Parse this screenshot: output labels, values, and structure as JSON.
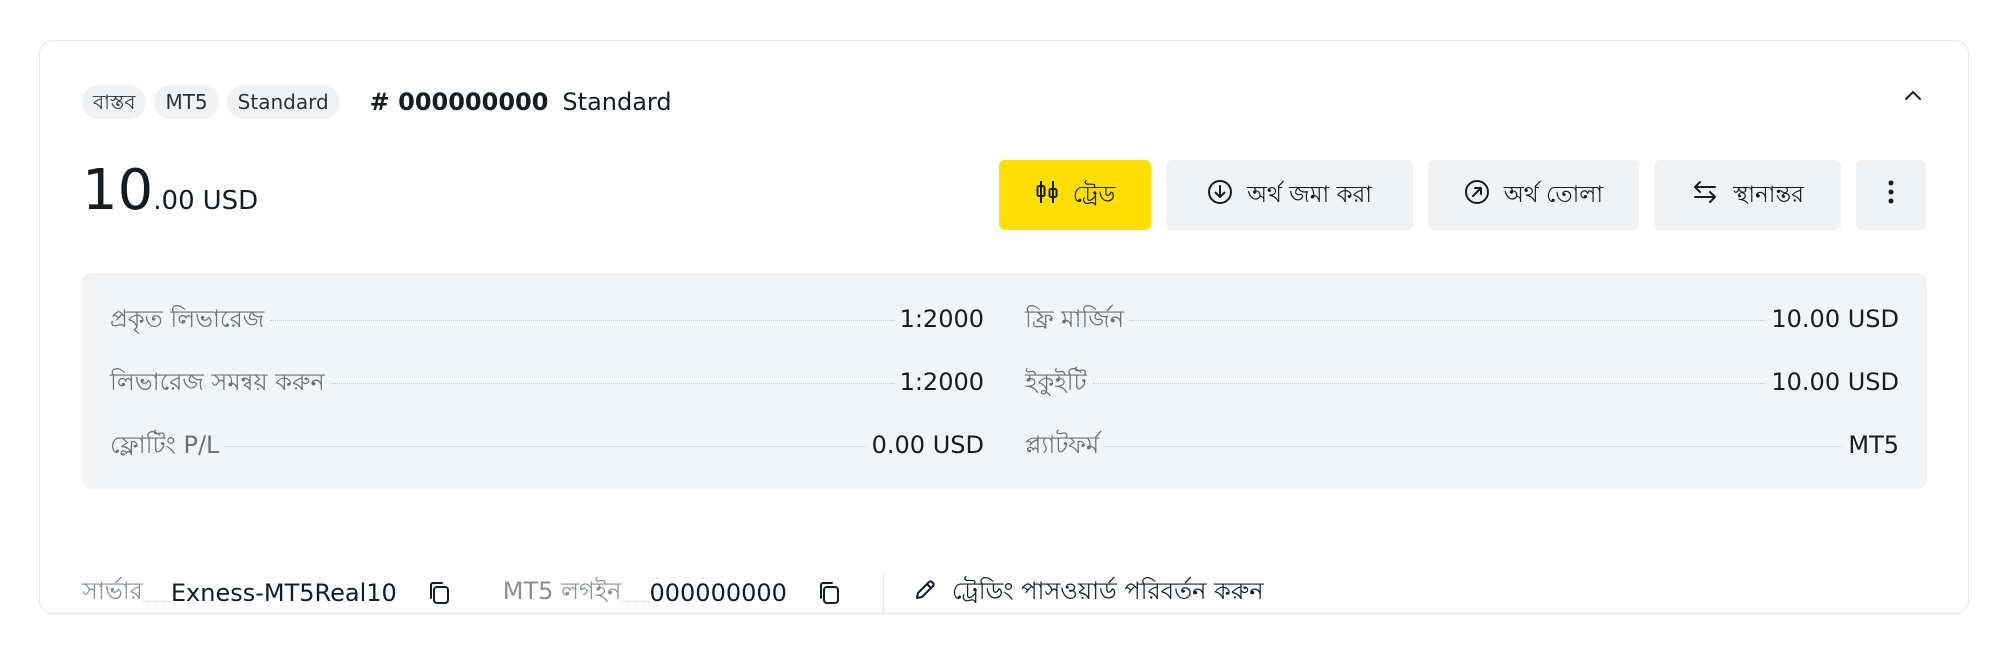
{
  "account": {
    "tags": [
      "বাস্তব",
      "MT5",
      "Standard"
    ],
    "number_label": "# 000000000",
    "type_label": "Standard"
  },
  "balance": {
    "integer": "10",
    "decimal": ".00",
    "currency": "USD"
  },
  "actions": {
    "trade": "ট্রেড",
    "deposit": "অর্থ জমা করা",
    "withdraw": "অর্থ তোলা",
    "transfer": "স্থানান্তর"
  },
  "details": {
    "left": [
      {
        "label": "প্রকৃত লিভারেজ",
        "value": "1:2000"
      },
      {
        "label": "লিভারেজ সমন্বয় করুন",
        "value": "1:2000"
      },
      {
        "label": "ফ্লোটিং P/L",
        "value": "0.00 USD"
      }
    ],
    "right": [
      {
        "label": "ফ্রি মার্জিন",
        "value": "10.00 USD"
      },
      {
        "label": "ইকুইটি",
        "value": "10.00 USD"
      },
      {
        "label": "প্ল্যাটফর্ম",
        "value": "MT5"
      }
    ]
  },
  "footer": {
    "server_label": "সার্ভার",
    "server_value": "Exness-MT5Real10",
    "login_label": "MT5 লগইন",
    "login_value": "000000000",
    "change_password": "ট্রেডিং পাসওয়ার্ড পরিবর্তন করুন"
  },
  "icons": {
    "collapse": "chevron-up-icon",
    "trade": "candlestick-icon",
    "deposit": "arrow-down-circle-icon",
    "withdraw": "arrow-up-right-circle-icon",
    "transfer": "swap-arrows-icon",
    "more": "more-vertical-icon",
    "copy": "copy-icon",
    "edit": "pencil-icon"
  },
  "colors": {
    "primary_button": "#ffde02",
    "panel_bg": "#f3f4f6"
  }
}
